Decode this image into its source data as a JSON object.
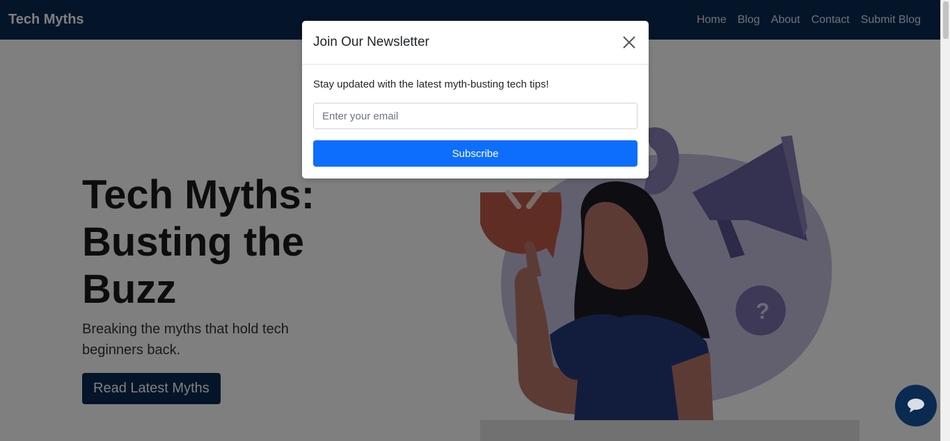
{
  "navbar": {
    "brand": "Tech Myths",
    "links": [
      "Home",
      "Blog",
      "About",
      "Contact",
      "Submit Blog"
    ]
  },
  "hero": {
    "title_line1": "Tech Myths:",
    "title_line2": "Busting the Buzz",
    "subtitle": "Breaking the myths that hold tech beginners back.",
    "button": "Read Latest Myths"
  },
  "modal": {
    "title": "Join Our Newsletter",
    "text": "Stay updated with the latest myth-busting tech tips!",
    "email_placeholder": "Enter your email",
    "email_value": "",
    "subscribe_label": "Subscribe"
  },
  "icons": {
    "close": "close-icon",
    "chat": "chat-bubble-icon"
  },
  "colors": {
    "navbar": "#0a2a52",
    "primary_button": "#0d6efd",
    "hero_button": "#0a2a52"
  }
}
